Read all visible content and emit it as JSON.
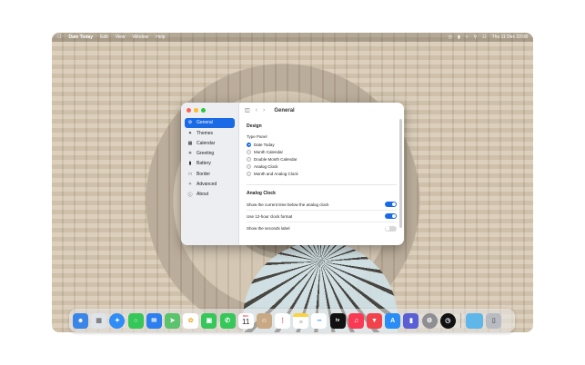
{
  "menubar": {
    "app_name": "Date Today",
    "menus": [
      "Edit",
      "View",
      "Window",
      "Help"
    ],
    "clock": "Thu 11 Dec  22:08"
  },
  "window": {
    "title": "General",
    "sidebar": [
      {
        "label": "General",
        "icon": "gear-icon",
        "selected": true
      },
      {
        "label": "Themes",
        "icon": "palette-icon"
      },
      {
        "label": "Calendar",
        "icon": "calendar-icon"
      },
      {
        "label": "Greeting",
        "icon": "sun-icon"
      },
      {
        "label": "Battery",
        "icon": "battery-icon"
      },
      {
        "label": "Border",
        "icon": "border-icon"
      },
      {
        "label": "Advanced",
        "icon": "advanced-icon"
      },
      {
        "label": "About",
        "icon": "info-icon"
      }
    ],
    "design": {
      "title": "Design",
      "type_panel_label": "Type Panel",
      "options": [
        "Date Today",
        "Month Calendar",
        "Double Month Calendar",
        "Analog Clock",
        "Month and Analog Clock"
      ],
      "selected_index": 0
    },
    "analog_clock": {
      "title": "Analog Clock",
      "settings": [
        {
          "label": "Show the current time below the analog clock",
          "on": true
        },
        {
          "label": "Use 12-hour clock format",
          "on": true
        },
        {
          "label": "Show the seconds label",
          "on": false
        }
      ]
    }
  },
  "dock": {
    "calendar_day": "11",
    "calendar_month": "DEC",
    "appletv_label": "tv",
    "colors": {
      "finder": "#3a86e8",
      "launchpad": "#dfe3ea",
      "safari": "#2f8df5",
      "messages": "#35c759",
      "mail": "#2d7ff0",
      "maps": "#5ac36b",
      "photos": "#f3b33d",
      "facetime": "#35c759",
      "phone": "#35c759",
      "calendar": "#ffffff",
      "contacts": "#c9a984",
      "reminders": "#ffffff",
      "notes": "#fbd23f",
      "freeform": "#ffffff",
      "appletv": "#111111",
      "music": "#fa3a55",
      "news": "#f2434c",
      "appstore": "#2a8cf6",
      "dictionary": "#5a5fd6",
      "settings": "#8e8e93",
      "clock": "#111111",
      "folder": "#5fb6e9",
      "trash": "#b8bcc2"
    }
  }
}
